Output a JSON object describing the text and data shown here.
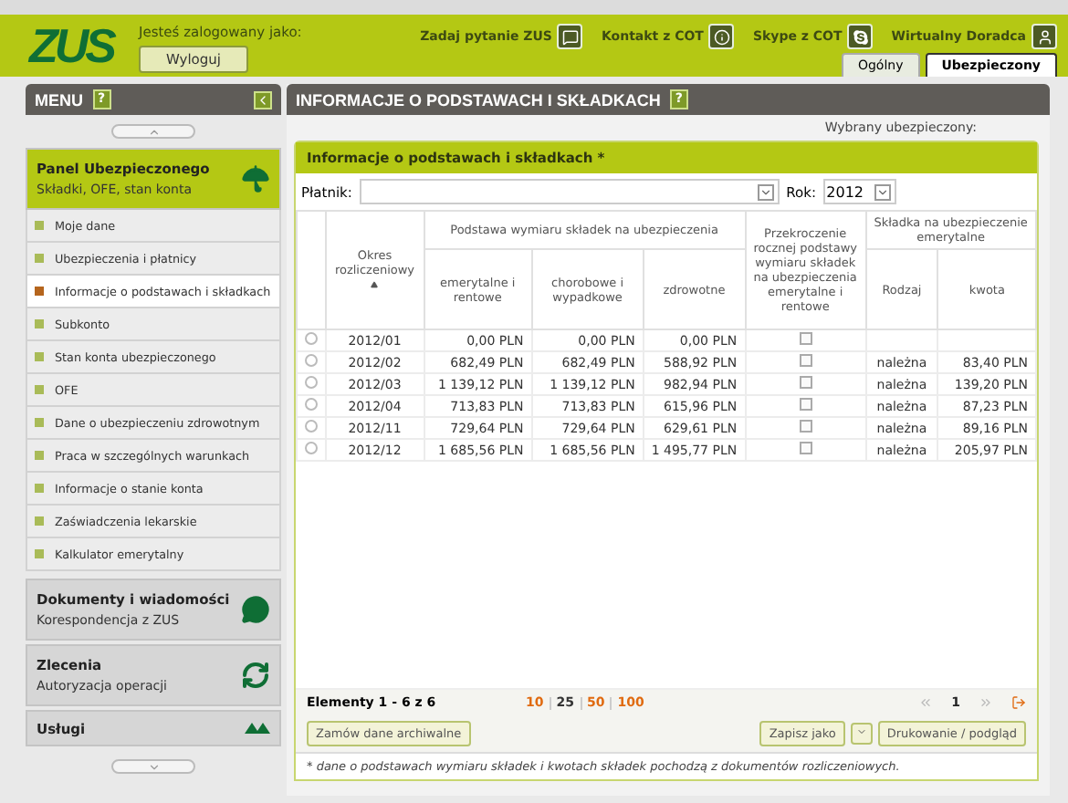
{
  "header": {
    "logo": "ZUS",
    "logged_in_label": "Jesteś zalogowany jako:",
    "logout_button": "Wyloguj",
    "links": [
      {
        "label": "Zadaj pytanie ZUS"
      },
      {
        "label": "Kontakt z COT"
      },
      {
        "label": "Skype z COT"
      },
      {
        "label": "Wirtualny Doradca"
      }
    ],
    "tabs": [
      {
        "label": "Ogólny",
        "selected": false
      },
      {
        "label": "Ubezpieczony",
        "selected": true
      }
    ]
  },
  "sidebar": {
    "title": "MENU",
    "help": "?",
    "sections": [
      {
        "title": "Panel Ubezpieczonego",
        "subtitle": "Składki, OFE, stan konta",
        "active": true,
        "items": [
          {
            "label": "Moje dane",
            "selected": false
          },
          {
            "label": "Ubezpieczenia i płatnicy",
            "selected": false
          },
          {
            "label": "Informacje o podstawach i składkach",
            "selected": true
          },
          {
            "label": "Subkonto",
            "selected": false
          },
          {
            "label": "Stan konta ubezpieczonego",
            "selected": false
          },
          {
            "label": "OFE",
            "selected": false
          },
          {
            "label": "Dane o ubezpieczeniu zdrowotnym",
            "selected": false
          },
          {
            "label": "Praca w szczególnych warunkach",
            "selected": false
          },
          {
            "label": "Informacje o stanie konta",
            "selected": false
          },
          {
            "label": "Zaświadczenia lekarskie",
            "selected": false
          },
          {
            "label": "Kalkulator emerytalny",
            "selected": false
          }
        ]
      },
      {
        "title": "Dokumenty i wiadomości",
        "subtitle": "Korespondencja z ZUS",
        "active": false
      },
      {
        "title": "Zlecenia",
        "subtitle": "Autoryzacja operacji",
        "active": false
      },
      {
        "title": "Usługi",
        "active": false
      }
    ]
  },
  "main": {
    "title": "INFORMACJE O PODSTAWACH I SKŁADKACH",
    "help": "?",
    "selected_insured_label": "Wybrany ubezpieczony:",
    "panel_title": "Informacje o podstawach i składkach *",
    "payer_label": "Płatnik:",
    "year_label": "Rok:",
    "year": "2012",
    "table": {
      "period_header": "Okres rozliczeniowy",
      "group_1": "Podstawa wymiaru składek na ubezpieczenia",
      "group_1_columns": [
        "emerytalne i rentowe",
        "chorobowe i wypadkowe",
        "zdrowotne"
      ],
      "exceed_header": "Przekroczenie rocznej podstawy wymiaru składek na ubezpieczenia emerytalne i rentowe",
      "group_2": "Składka na ubezpieczenie emerytalne",
      "group_2_columns": [
        "Rodzaj",
        "kwota"
      ],
      "rows": [
        {
          "period": "2012/01",
          "pension": "0,00 PLN",
          "sickness": "0,00 PLN",
          "health": "0,00 PLN",
          "exceeded": false,
          "selected": false
        },
        {
          "period": "2012/02",
          "pension": "682,49 PLN",
          "sickness": "682,49 PLN",
          "health": "588,92 PLN",
          "exceeded": false,
          "kind": "należna",
          "amount": "83,40 PLN",
          "selected": false
        },
        {
          "period": "2012/03",
          "pension": "1 139,12 PLN",
          "sickness": "1 139,12 PLN",
          "health": "982,94 PLN",
          "exceeded": false,
          "kind": "należna",
          "amount": "139,20 PLN",
          "selected": false
        },
        {
          "period": "2012/04",
          "pension": "713,83 PLN",
          "sickness": "713,83 PLN",
          "health": "615,96 PLN",
          "exceeded": false,
          "kind": "należna",
          "amount": "87,23 PLN",
          "selected": false
        },
        {
          "period": "2012/11",
          "pension": "729,64 PLN",
          "sickness": "729,64 PLN",
          "health": "629,61 PLN",
          "exceeded": false,
          "kind": "należna",
          "amount": "89,16 PLN",
          "selected": false
        },
        {
          "period": "2012/12",
          "pension": "1 685,56 PLN",
          "sickness": "1 685,56 PLN",
          "health": "1 495,77 PLN",
          "exceeded": false,
          "kind": "należna",
          "amount": "205,97 PLN",
          "selected": false
        }
      ]
    },
    "pager": {
      "summary": "Elementy 1 - 6 z 6",
      "page_sizes": [
        {
          "label": "10",
          "selected": false
        },
        {
          "label": "25",
          "selected": true
        },
        {
          "label": "50",
          "selected": false
        },
        {
          "label": "100",
          "selected": false
        }
      ],
      "page": "1"
    },
    "buttons": {
      "archive": "Zamów dane archiwalne",
      "save_as": "Zapisz jako",
      "print": "Drukowanie / podgląd"
    },
    "footnote": "* dane o podstawach wymiaru składek i kwotach składek pochodzą z dokumentów rozliczeniowych."
  }
}
